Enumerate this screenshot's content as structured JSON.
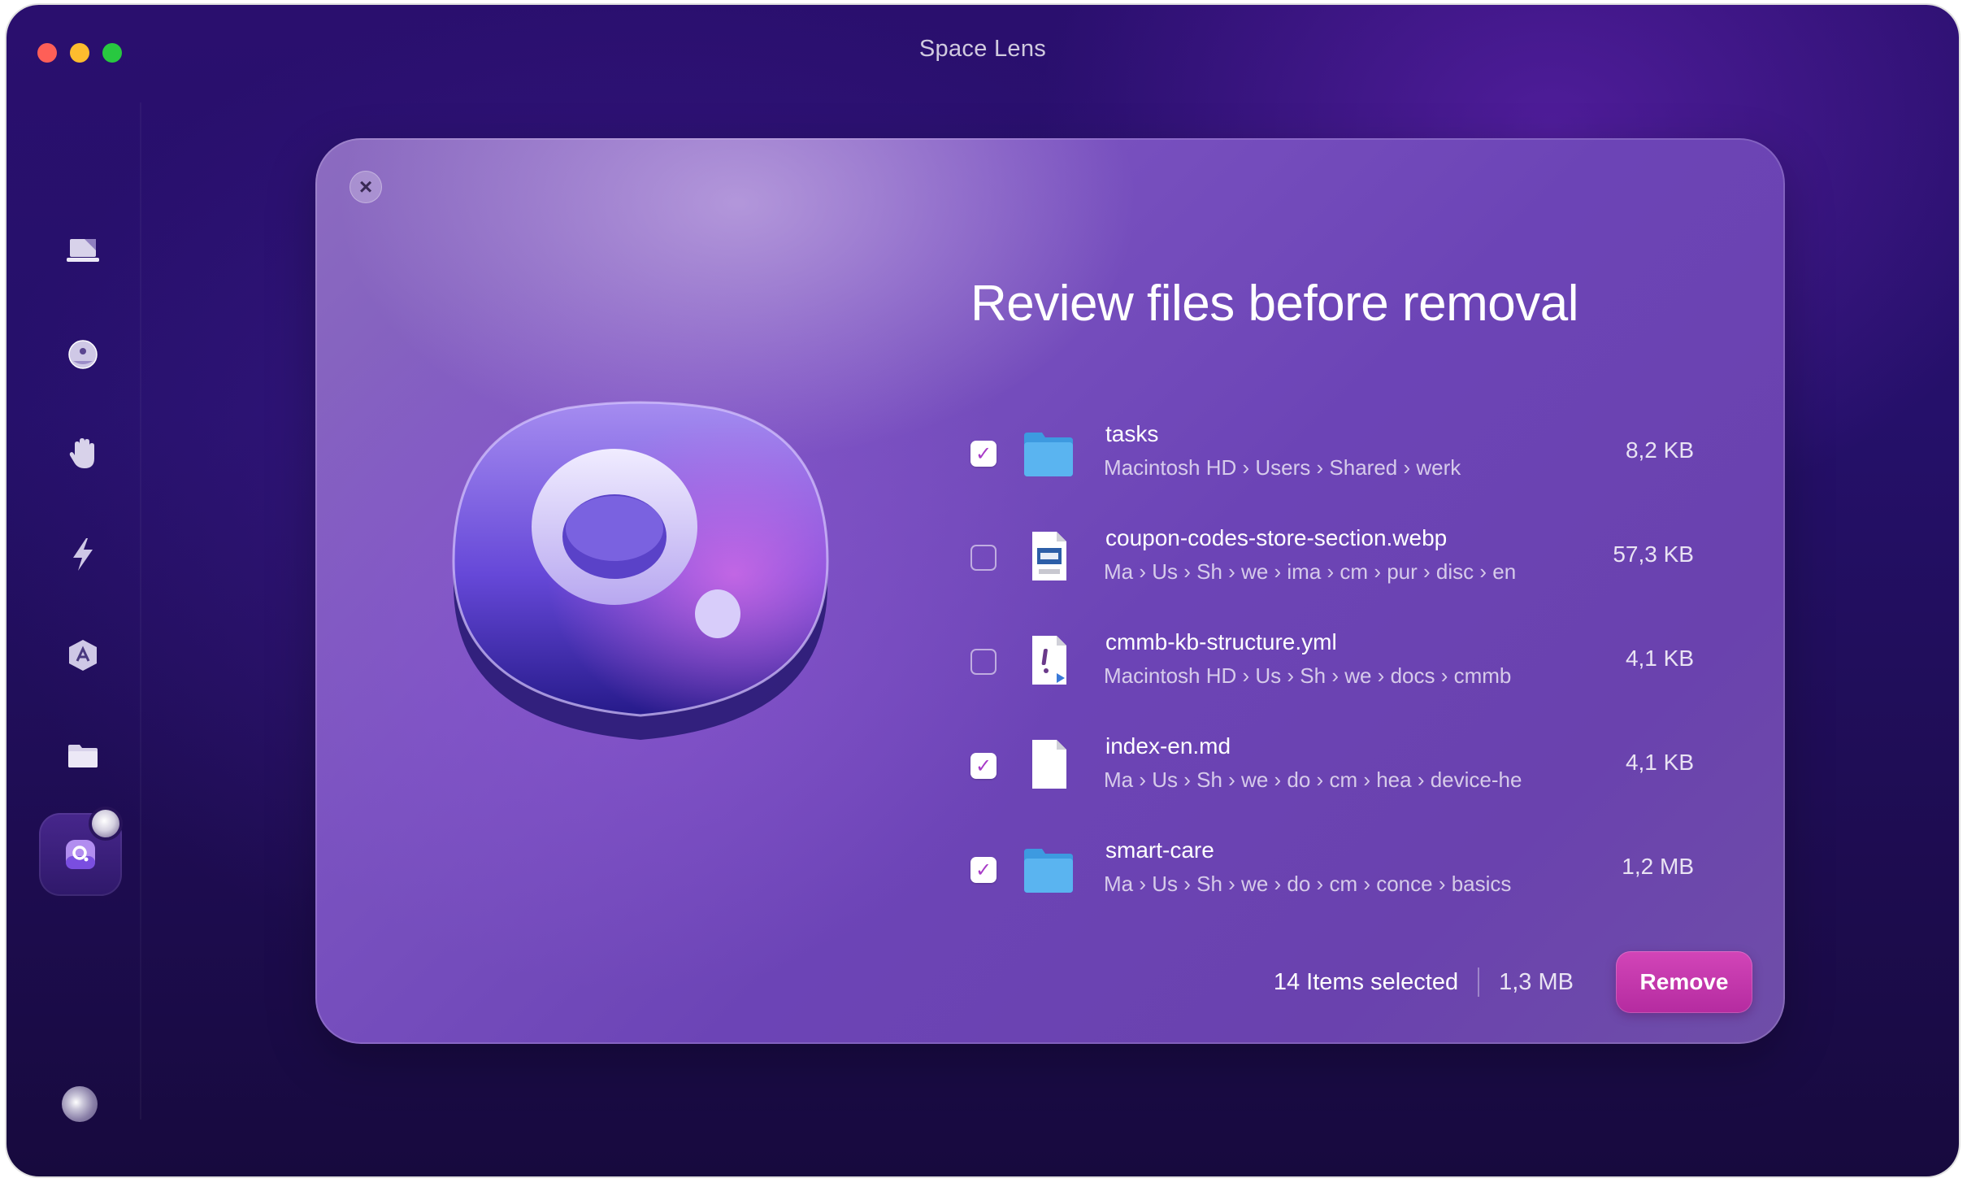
{
  "window": {
    "title": "Space Lens"
  },
  "sidebar": {
    "items": [
      {
        "icon": "laptop-cleanup-icon",
        "active": false
      },
      {
        "icon": "protection-globe-icon",
        "active": false
      },
      {
        "icon": "privacy-hand-icon",
        "active": false
      },
      {
        "icon": "performance-bolt-icon",
        "active": false
      },
      {
        "icon": "applications-icon",
        "active": false
      },
      {
        "icon": "files-folder-icon",
        "active": false
      },
      {
        "icon": "space-lens-icon",
        "active": true
      }
    ],
    "bottom_icon": "assistant-orb-icon"
  },
  "dialog": {
    "close_icon": "close-icon",
    "heading": "Review files before removal",
    "files": [
      {
        "name": "tasks",
        "path": [
          "Macintosh HD",
          "Users",
          "Shared",
          "werk"
        ],
        "size": "8,2 KB",
        "checked": true,
        "icon": "folder-icon"
      },
      {
        "name": "coupon-codes-store-section.webp",
        "path": [
          "Ma",
          "Us",
          "Sh",
          "we",
          "ima",
          "cm",
          "pur",
          "disc",
          "en"
        ],
        "size": "57,3 KB",
        "checked": false,
        "icon": "webp-file-icon"
      },
      {
        "name": "cmmb-kb-structure.yml",
        "path": [
          "Macintosh HD",
          "Us",
          "Sh",
          "we",
          "docs",
          "cmmb"
        ],
        "size": "4,1 KB",
        "checked": false,
        "icon": "yml-file-icon"
      },
      {
        "name": "index-en.md",
        "path": [
          "Ma",
          "Us",
          "Sh",
          "we",
          "do",
          "cm",
          "hea",
          "device-he"
        ],
        "size": "4,1 KB",
        "checked": true,
        "icon": "document-file-icon"
      },
      {
        "name": "smart-care",
        "path": [
          "Ma",
          "Us",
          "Sh",
          "we",
          "do",
          "cm",
          "conce",
          "basics"
        ],
        "size": "1,2 MB",
        "checked": true,
        "icon": "folder-icon"
      }
    ],
    "footer": {
      "selected_label": "14 Items selected",
      "selected_size": "1,3 MB",
      "remove_label": "Remove"
    }
  },
  "colors": {
    "accent": "#c53aae",
    "checkmark": "#a83cc8",
    "folder": "#5ab4f0"
  }
}
